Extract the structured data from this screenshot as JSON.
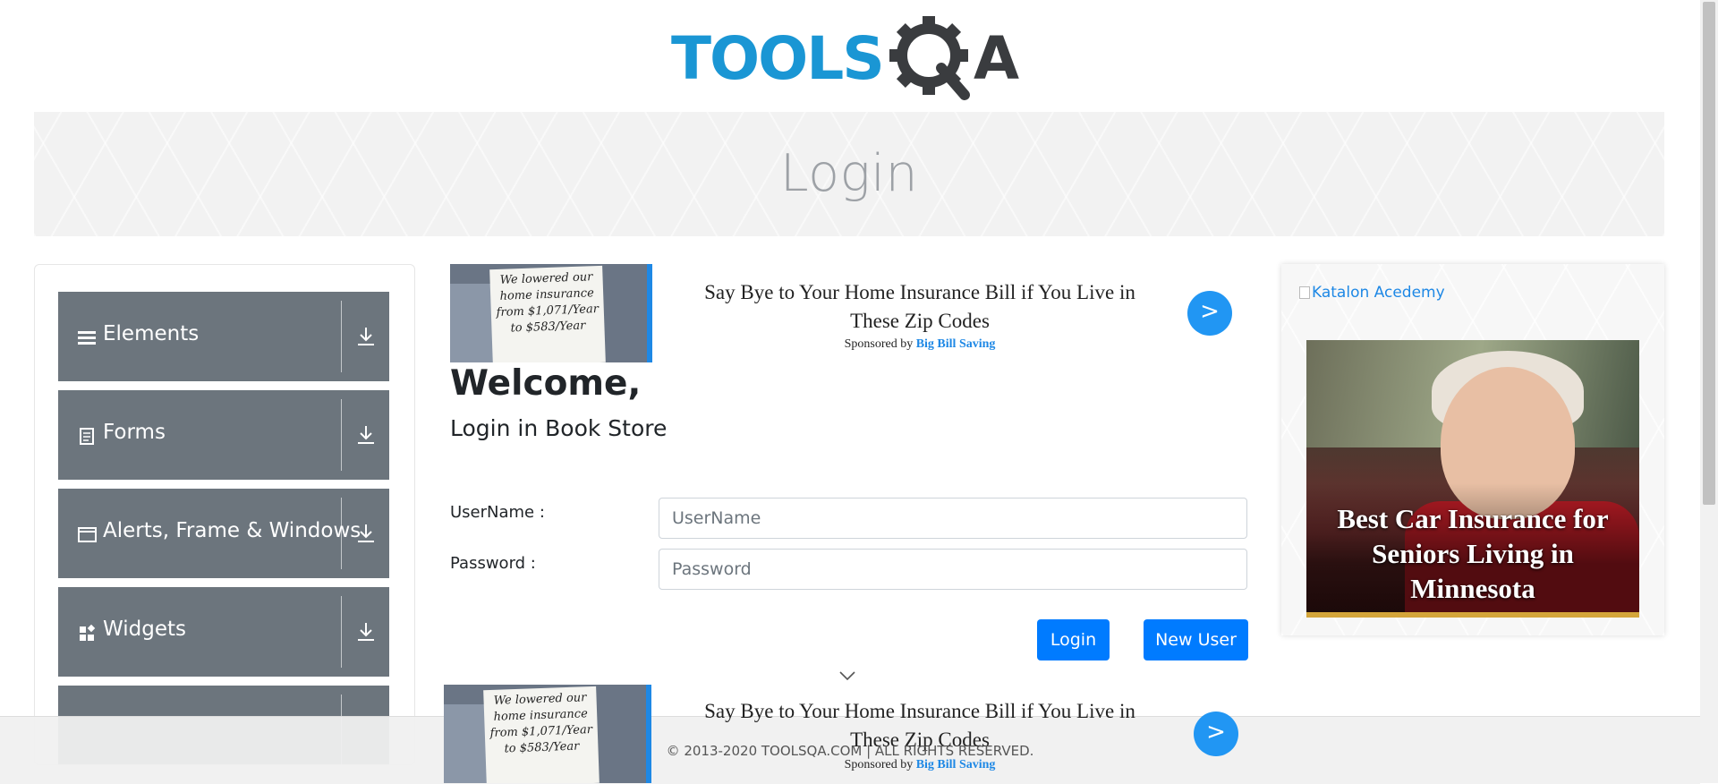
{
  "header": {
    "logo_text": "TOOLSQA",
    "banner_title": "Login"
  },
  "sidebar": {
    "groups": [
      {
        "label": "Elements",
        "icon": "hamburger-icon"
      },
      {
        "label": "Forms",
        "icon": "document-icon"
      },
      {
        "label": "Alerts, Frame & Windows",
        "icon": "window-icon"
      },
      {
        "label": "Widgets",
        "icon": "widgets-icon"
      },
      {
        "label": "",
        "icon": "interactions-icon"
      }
    ]
  },
  "ad_top": {
    "sign_text": "We lowered our home insurance from $1,071/Year to $583/Year",
    "headline": "Say Bye to Your Home Insurance Bill if You Live in These Zip Codes",
    "sponsored_prefix": "Sponsored by",
    "sponsor": "Big Bill Saving",
    "go": ">"
  },
  "ad_bottom": {
    "sign_text": "We lowered our home insurance from $1,071/Year to $583/Year",
    "headline": "Say Bye to Your Home Insurance Bill if You Live in These Zip Codes",
    "sponsored_prefix": "Sponsored by",
    "sponsor": "Big Bill Saving",
    "go": ">"
  },
  "main": {
    "welcome": "Welcome,",
    "subtitle": "Login in Book Store",
    "username_label": "UserName :",
    "username_placeholder": "UserName",
    "password_label": "Password :",
    "password_placeholder": "Password",
    "login_button": "Login",
    "new_user_button": "New User"
  },
  "right_ad": {
    "katalon_alt": "Katalon Acedemy",
    "car_ad_text": "Best Car Insurance for Seniors Living in Minnesota"
  },
  "footer": {
    "copyright": "© 2013-2020 TOOLSQA.COM | ALL RIGHTS RESERVED."
  },
  "colors": {
    "primary": "#007bff",
    "sidebar_group": "#6c757d",
    "logo_blue": "#1a96d4",
    "logo_dark": "#3a3c3f"
  }
}
